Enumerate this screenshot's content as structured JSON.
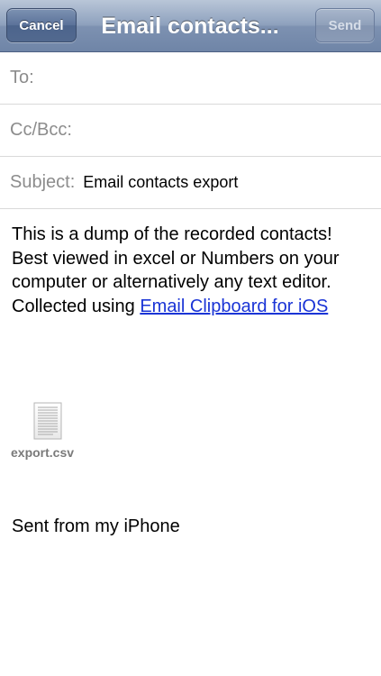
{
  "navbar": {
    "title": "Email contacts...",
    "cancel_label": "Cancel",
    "send_label": "Send"
  },
  "fields": {
    "to_label": "To:",
    "to_value": "",
    "cc_label": "Cc/Bcc:",
    "cc_value": "",
    "subject_label": "Subject:",
    "subject_value": "Email contacts export"
  },
  "body": {
    "text": "This is a dump of the recorded contacts! Best viewed in excel or Numbers on your computer or alternatively any text editor. Collected using ",
    "link_text": "Email Clipboard for iOS"
  },
  "attachment": {
    "filename": "export.csv",
    "icon": "document-icon"
  },
  "signature": "Sent from my iPhone",
  "colors": {
    "navbar": "#8ea1bd",
    "link": "#1a34d6",
    "label": "#8c8c8c"
  }
}
